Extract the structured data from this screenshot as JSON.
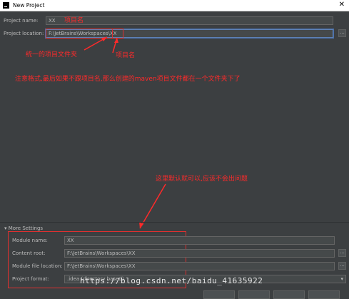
{
  "window": {
    "title": "New Project"
  },
  "form": {
    "project_name_label": "Project name:",
    "project_name_value": "XX",
    "project_location_label": "Project location:",
    "project_location_value": "F:\\JetBrains\\Workspaces\\XX",
    "browse_label": "..."
  },
  "annotations": {
    "project_name_note": "项目名",
    "unified_folder_note": "统一的项目文件夹",
    "project_name_note2": "项目名",
    "format_note": "注意格式,最后如果不跟项目名,那么创建的maven项目文件都在一个文件夹下了",
    "default_ok_note": "这里默认就可以,应该不会出问题"
  },
  "more_settings": {
    "toggle_label": "More Settings",
    "module_name_label": "Module name:",
    "module_name_value": "XX",
    "content_root_label": "Content root:",
    "content_root_value": "F:\\JetBrains\\Workspaces\\XX",
    "module_file_location_label": "Module file location:",
    "module_file_location_value": "F:\\JetBrains\\Workspaces\\XX",
    "project_format_label": "Project format:",
    "project_format_value": ".idea (directory based)"
  },
  "watermark": "https://blog.csdn.net/baidu_41635922",
  "colors": {
    "annotation_red": "#ff2a2a",
    "focus_border": "#5e81b5",
    "background": "#3c3f41"
  }
}
